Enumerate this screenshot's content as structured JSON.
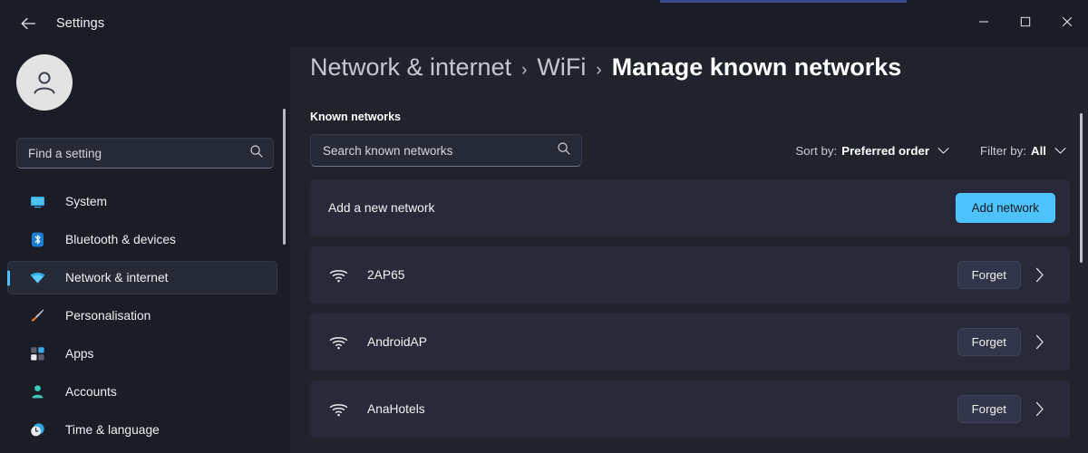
{
  "window": {
    "app_title": "Settings",
    "back_icon": "arrow-left-icon",
    "controls": {
      "minimize": "minimize-icon",
      "maximize": "maximize-icon",
      "close": "close-icon"
    }
  },
  "sidebar": {
    "avatar_icon": "user-avatar-icon",
    "search": {
      "placeholder": "Find a setting",
      "value": "",
      "icon": "search-icon"
    },
    "items": [
      {
        "label": "System",
        "icon": "monitor-icon",
        "active": false
      },
      {
        "label": "Bluetooth & devices",
        "icon": "bluetooth-icon",
        "active": false
      },
      {
        "label": "Network & internet",
        "icon": "wifi-icon",
        "active": true
      },
      {
        "label": "Personalisation",
        "icon": "paintbrush-icon",
        "active": false
      },
      {
        "label": "Apps",
        "icon": "apps-grid-icon",
        "active": false
      },
      {
        "label": "Accounts",
        "icon": "person-icon",
        "active": false
      },
      {
        "label": "Time & language",
        "icon": "clock-icon",
        "active": false
      }
    ],
    "scrollbar": "sidebar-scrollbar"
  },
  "main": {
    "breadcrumb": {
      "items": [
        "Network & internet",
        "WiFi"
      ],
      "separator": "›",
      "current": "Manage known networks"
    },
    "section_label": "Known networks",
    "search": {
      "placeholder": "Search known networks",
      "value": "",
      "icon": "search-icon"
    },
    "sort": {
      "prefix": "Sort by:",
      "value": "Preferred order",
      "chevron": "chevron-down-icon"
    },
    "filter": {
      "prefix": "Filter by:",
      "value": "All",
      "chevron": "chevron-down-icon"
    },
    "add_network": {
      "title": "Add a new network",
      "button_label": "Add network"
    },
    "networks": [
      {
        "name": "2AP65",
        "icon": "wifi-icon",
        "action_label": "Forget",
        "chevron": "chevron-right-icon"
      },
      {
        "name": "AndroidAP",
        "icon": "wifi-icon",
        "action_label": "Forget",
        "chevron": "chevron-right-icon"
      },
      {
        "name": "AnaHotels",
        "icon": "wifi-icon",
        "action_label": "Forget",
        "chevron": "chevron-right-icon"
      }
    ],
    "scrollbar": "content-scrollbar"
  },
  "colors": {
    "accent": "#4cc2ff",
    "window_bg": "#20222c",
    "sidebar_bg": "#1b1d26",
    "card_bg": "#282a3a",
    "top_accent": "#3b4a8f"
  }
}
